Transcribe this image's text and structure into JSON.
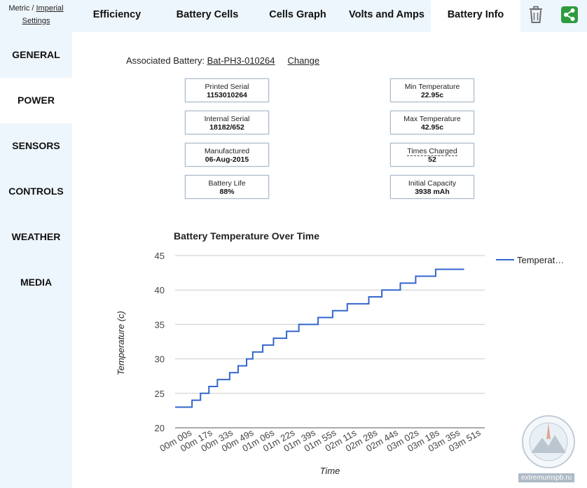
{
  "units": {
    "metric": "Metric",
    "sep": " / ",
    "imperial": "Imperial",
    "settings": "Settings"
  },
  "tabs": [
    {
      "label": "Efficiency",
      "active": false
    },
    {
      "label": "Battery Cells",
      "active": false
    },
    {
      "label": "Cells Graph",
      "active": false
    },
    {
      "label": "Volts and Amps",
      "active": false
    },
    {
      "label": "Battery Info",
      "active": true
    }
  ],
  "tab_icons": {
    "delete": "trash-icon",
    "share": "share-icon",
    "share_color": "#2e9b3e"
  },
  "sidebar": [
    {
      "label": "GENERAL",
      "active": false
    },
    {
      "label": "POWER",
      "active": true
    },
    {
      "label": "SENSORS",
      "active": false
    },
    {
      "label": "CONTROLS",
      "active": false
    },
    {
      "label": "WEATHER",
      "active": false
    },
    {
      "label": "MEDIA",
      "active": false
    }
  ],
  "battery": {
    "assoc_label": "Associated Battery:",
    "assoc_id": "Bat-PH3-010264",
    "change": "Change",
    "left": [
      {
        "label": "Printed Serial",
        "value": "1153010264"
      },
      {
        "label": "Internal Serial",
        "value": "18182/652"
      },
      {
        "label": "Manufactured",
        "value": "06-Aug-2015"
      },
      {
        "label": "Battery Life",
        "value": "88%"
      }
    ],
    "right": [
      {
        "label": "Min Temperature",
        "value": "22.95c"
      },
      {
        "label": "Max Temperature",
        "value": "42.95c"
      },
      {
        "label": "Times Charged",
        "value": "52"
      },
      {
        "label": "Initial Capacity",
        "value": "3938 mAh"
      }
    ]
  },
  "chart_data": {
    "type": "line",
    "title": "Battery Temperature Over Time",
    "xlabel": "Time",
    "ylabel": "Temperature (c)",
    "ylim": [
      20,
      45
    ],
    "yticks": [
      20,
      25,
      30,
      35,
      40,
      45
    ],
    "grid": true,
    "legend_position": "top-right",
    "series": [
      {
        "name": "Temperat…",
        "color": "#3366cc"
      }
    ],
    "x_tick_labels": [
      "00m 00s",
      "00m 17s",
      "00m 33s",
      "00m 49s",
      "01m 06s",
      "01m 22s",
      "01m 39s",
      "01m 55s",
      "02m 11s",
      "02m 28s",
      "02m 44s",
      "03m 02s",
      "03m 18s",
      "03m 35s",
      "03m 51s"
    ],
    "steps": [
      [
        0,
        23
      ],
      [
        0.11,
        24
      ],
      [
        0.165,
        25
      ],
      [
        0.22,
        26
      ],
      [
        0.275,
        27
      ],
      [
        0.355,
        28
      ],
      [
        0.41,
        29
      ],
      [
        0.465,
        30
      ],
      [
        0.505,
        31
      ],
      [
        0.57,
        32
      ],
      [
        0.64,
        33
      ],
      [
        0.725,
        34
      ],
      [
        0.805,
        35
      ],
      [
        0.93,
        36
      ],
      [
        1.025,
        37
      ],
      [
        1.12,
        38
      ],
      [
        1.26,
        39
      ],
      [
        1.345,
        40
      ],
      [
        1.465,
        41
      ],
      [
        1.565,
        42
      ],
      [
        1.695,
        43
      ],
      [
        1.88,
        43
      ]
    ]
  },
  "watermark": {
    "text": "extremumspb.ru"
  }
}
